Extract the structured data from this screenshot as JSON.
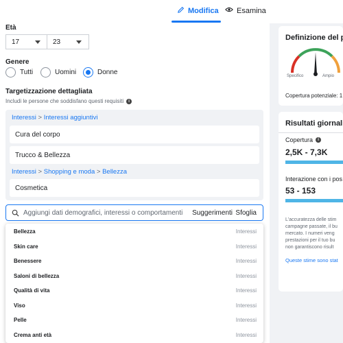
{
  "tabs": [
    {
      "label": "Modifica",
      "icon": "pencil-icon",
      "active": true
    },
    {
      "label": "Esamina",
      "icon": "eye-icon",
      "active": false
    }
  ],
  "age": {
    "label": "Età",
    "min": "17",
    "max": "23"
  },
  "gender": {
    "label": "Genere",
    "options": [
      "Tutti",
      "Uomini",
      "Donne"
    ],
    "selected": "Donne"
  },
  "detailed_targeting": {
    "title": "Targetizzazione dettagliata",
    "subtitle": "Includi le persone che soddisfano questi requisiti",
    "groups": [
      {
        "breadcrumb": [
          "Interessi",
          "Interessi aggiuntivi"
        ],
        "items": [
          "Cura del corpo",
          "Trucco & Bellezza"
        ]
      },
      {
        "breadcrumb": [
          "Interessi",
          "Shopping e moda",
          "Bellezza"
        ],
        "items": [
          "Cosmetica"
        ]
      }
    ]
  },
  "search": {
    "placeholder": "Aggiungi dati demografici, interessi o comportamenti",
    "suggestions_label": "Suggerimenti",
    "browse_label": "Sfoglia"
  },
  "suggestions": [
    {
      "name": "Bellezza",
      "type": "Interessi"
    },
    {
      "name": "Skin care",
      "type": "Interessi"
    },
    {
      "name": "Benessere",
      "type": "Interessi"
    },
    {
      "name": "Saloni di bellezza",
      "type": "Interessi"
    },
    {
      "name": "Qualità di vita",
      "type": "Interessi"
    },
    {
      "name": "Viso",
      "type": "Interessi"
    },
    {
      "name": "Pelle",
      "type": "Interessi"
    },
    {
      "name": "Crema anti età",
      "type": "Interessi"
    }
  ],
  "audience_definition": {
    "title": "Definizione del pu",
    "gauge_left": "Specifico",
    "gauge_right": "Ampio",
    "potential_reach": "Copertura potenziale: 1"
  },
  "daily_results": {
    "title": "Risultati giornalie",
    "reach_label": "Copertura",
    "reach_value": "2,5K - 7,3K",
    "interaction_label": "Interazione con i pos",
    "interaction_value": "53 - 153",
    "disclaimer": [
      "L'accuratezza delle stim",
      "campagne passate, il bu",
      "mercato. I numeri veng",
      "prestazioni per il tuo bu",
      "non garantiscono risult"
    ],
    "link": "Queste stime sono stat"
  },
  "colors": {
    "accent": "#1877f2",
    "bar": "#4fb5e6",
    "gauge_red": "#d93025",
    "gauge_green": "#3da35a",
    "gauge_orange": "#f0a03c"
  }
}
